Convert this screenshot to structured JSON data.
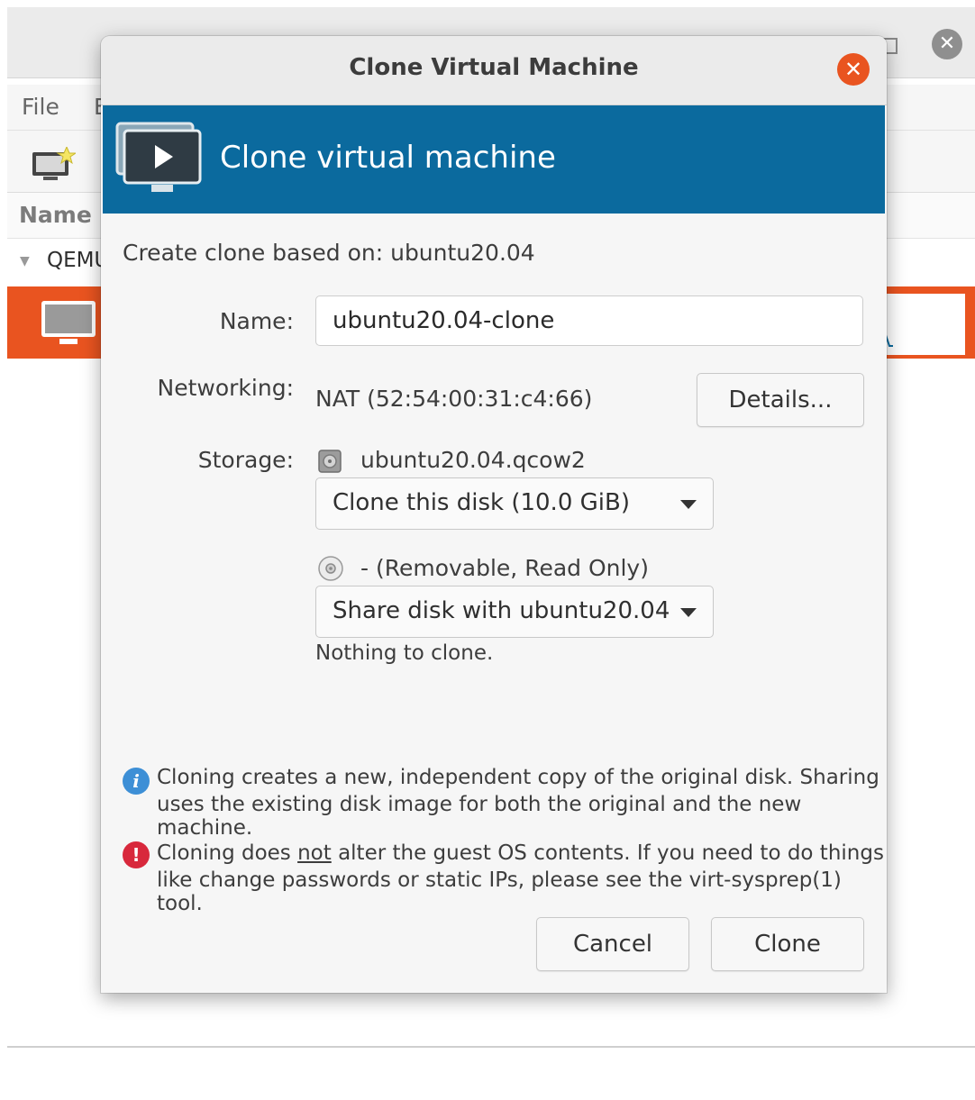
{
  "background": {
    "title": "",
    "menu": {
      "file": "File",
      "edit": "E"
    },
    "header_name": "Name",
    "connection": "QEMU",
    "vm_graph_fragment": "M"
  },
  "dialog": {
    "title": "Clone Virtual Machine",
    "banner_text": "Clone virtual machine",
    "based_on": "Create clone based on:  ubuntu20.04",
    "name_label": "Name:",
    "name_value": "ubuntu20.04-clone",
    "networking_label": "Networking:",
    "networking_value": "NAT (52:54:00:31:c4:66)",
    "details_button": "Details...",
    "storage_label": "Storage:",
    "disks": [
      {
        "name": "ubuntu20.04.qcow2",
        "option": "Clone this disk (10.0 GiB)",
        "icon": "hard-disk-icon"
      },
      {
        "name": "- (Removable, Read Only)",
        "option": "Share disk with ubuntu20.04",
        "icon": "cdrom-icon",
        "note": "Nothing to clone."
      }
    ],
    "info_line1": "Cloning creates a new, independent copy of the original disk. Sharing",
    "info_line2": "uses the existing disk image for both the original and the new machine.",
    "warn_pre": "Cloning does ",
    "warn_emph": "not",
    "warn_post": " alter the guest OS contents. If you need to do things",
    "warn_line2": "like change passwords or static IPs, please see the virt-sysprep(1) tool.",
    "cancel_button": "Cancel",
    "clone_button": "Clone"
  },
  "colors": {
    "accent": "#e95420",
    "banner": "#0b6a9e",
    "info": "#3d8fd6",
    "warning": "#d8283c"
  }
}
